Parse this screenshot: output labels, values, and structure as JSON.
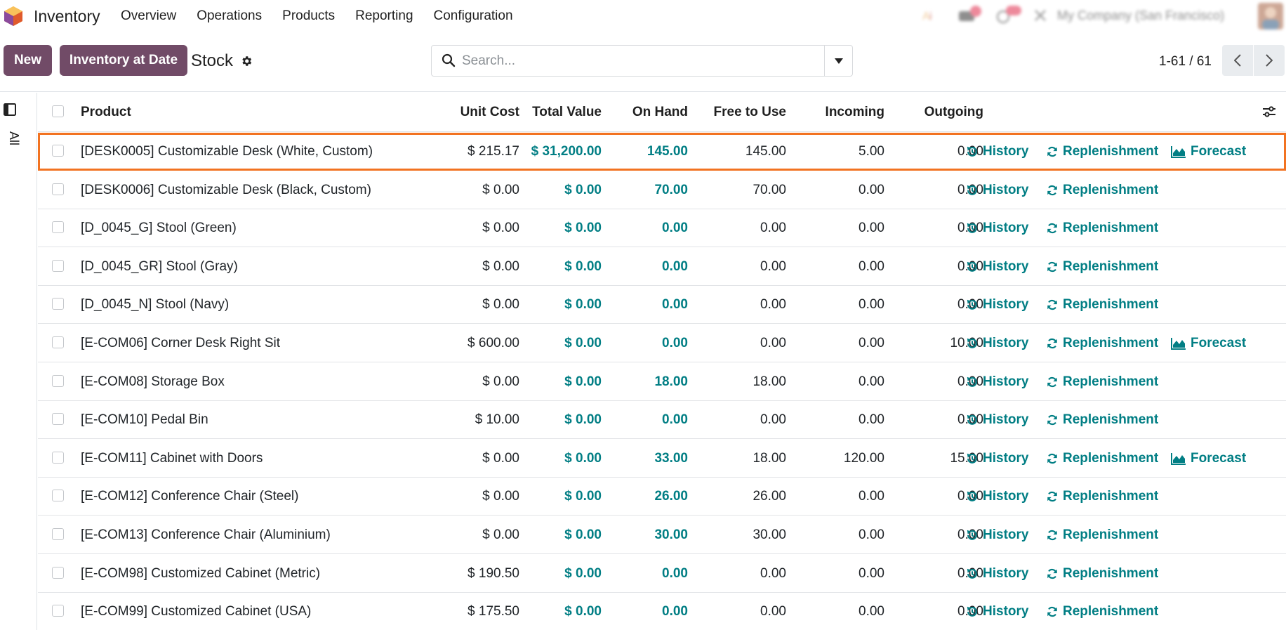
{
  "app": {
    "name": "Inventory"
  },
  "menu": [
    "Overview",
    "Operations",
    "Products",
    "Reporting",
    "Configuration"
  ],
  "systray": {
    "company": "My Company (San Francisco)"
  },
  "toolbar": {
    "new_label": "New",
    "inventory_at_date_label": "Inventory at Date"
  },
  "breadcrumb": {
    "title": "Stock"
  },
  "search": {
    "placeholder": "Search...",
    "value": ""
  },
  "pager": {
    "value": "1-61 / 61"
  },
  "sidepanel": {
    "filter_label": "All"
  },
  "table": {
    "headers": {
      "product": "Product",
      "unit_cost": "Unit Cost",
      "total_value": "Total Value",
      "on_hand": "On Hand",
      "free_to_use": "Free to Use",
      "incoming": "Incoming",
      "outgoing": "Outgoing"
    },
    "actions": {
      "history": "History",
      "replenishment": "Replenishment",
      "forecast": "Forecast"
    },
    "rows": [
      {
        "product": "[DESK0005] Customizable Desk (White, Custom)",
        "unit_cost": "$ 215.17",
        "total_value": "$ 31,200.00",
        "on_hand": "145.00",
        "free": "145.00",
        "incoming": "5.00",
        "outgoing": "0.00",
        "forecast": true,
        "highlight": true
      },
      {
        "product": "[DESK0006] Customizable Desk (Black, Custom)",
        "unit_cost": "$ 0.00",
        "total_value": "$ 0.00",
        "on_hand": "70.00",
        "free": "70.00",
        "incoming": "0.00",
        "outgoing": "0.00",
        "forecast": false
      },
      {
        "product": "[D_0045_G] Stool (Green)",
        "unit_cost": "$ 0.00",
        "total_value": "$ 0.00",
        "on_hand": "0.00",
        "free": "0.00",
        "incoming": "0.00",
        "outgoing": "0.00",
        "forecast": false
      },
      {
        "product": "[D_0045_GR] Stool (Gray)",
        "unit_cost": "$ 0.00",
        "total_value": "$ 0.00",
        "on_hand": "0.00",
        "free": "0.00",
        "incoming": "0.00",
        "outgoing": "0.00",
        "forecast": false
      },
      {
        "product": "[D_0045_N] Stool (Navy)",
        "unit_cost": "$ 0.00",
        "total_value": "$ 0.00",
        "on_hand": "0.00",
        "free": "0.00",
        "incoming": "0.00",
        "outgoing": "0.00",
        "forecast": false
      },
      {
        "product": "[E-COM06] Corner Desk Right Sit",
        "unit_cost": "$ 600.00",
        "total_value": "$ 0.00",
        "on_hand": "0.00",
        "free": "0.00",
        "incoming": "0.00",
        "outgoing": "10.00",
        "forecast": true
      },
      {
        "product": "[E-COM08] Storage Box",
        "unit_cost": "$ 0.00",
        "total_value": "$ 0.00",
        "on_hand": "18.00",
        "free": "18.00",
        "incoming": "0.00",
        "outgoing": "0.00",
        "forecast": false
      },
      {
        "product": "[E-COM10] Pedal Bin",
        "unit_cost": "$ 10.00",
        "total_value": "$ 0.00",
        "on_hand": "0.00",
        "free": "0.00",
        "incoming": "0.00",
        "outgoing": "0.00",
        "forecast": false
      },
      {
        "product": "[E-COM11] Cabinet with Doors",
        "unit_cost": "$ 0.00",
        "total_value": "$ 0.00",
        "on_hand": "33.00",
        "free": "18.00",
        "incoming": "120.00",
        "outgoing": "15.00",
        "forecast": true
      },
      {
        "product": "[E-COM12] Conference Chair (Steel)",
        "unit_cost": "$ 0.00",
        "total_value": "$ 0.00",
        "on_hand": "26.00",
        "free": "26.00",
        "incoming": "0.00",
        "outgoing": "0.00",
        "forecast": false
      },
      {
        "product": "[E-COM13] Conference Chair (Aluminium)",
        "unit_cost": "$ 0.00",
        "total_value": "$ 0.00",
        "on_hand": "30.00",
        "free": "30.00",
        "incoming": "0.00",
        "outgoing": "0.00",
        "forecast": false
      },
      {
        "product": "[E-COM98] Customized Cabinet (Metric)",
        "unit_cost": "$ 190.50",
        "total_value": "$ 0.00",
        "on_hand": "0.00",
        "free": "0.00",
        "incoming": "0.00",
        "outgoing": "0.00",
        "forecast": false
      },
      {
        "product": "[E-COM99] Customized Cabinet (USA)",
        "unit_cost": "$ 175.50",
        "total_value": "$ 0.00",
        "on_hand": "0.00",
        "free": "0.00",
        "incoming": "0.00",
        "outgoing": "0.00",
        "forecast": false
      }
    ]
  },
  "colors": {
    "brand": "#714b67",
    "link": "#017e84",
    "highlight": "#f27321"
  }
}
